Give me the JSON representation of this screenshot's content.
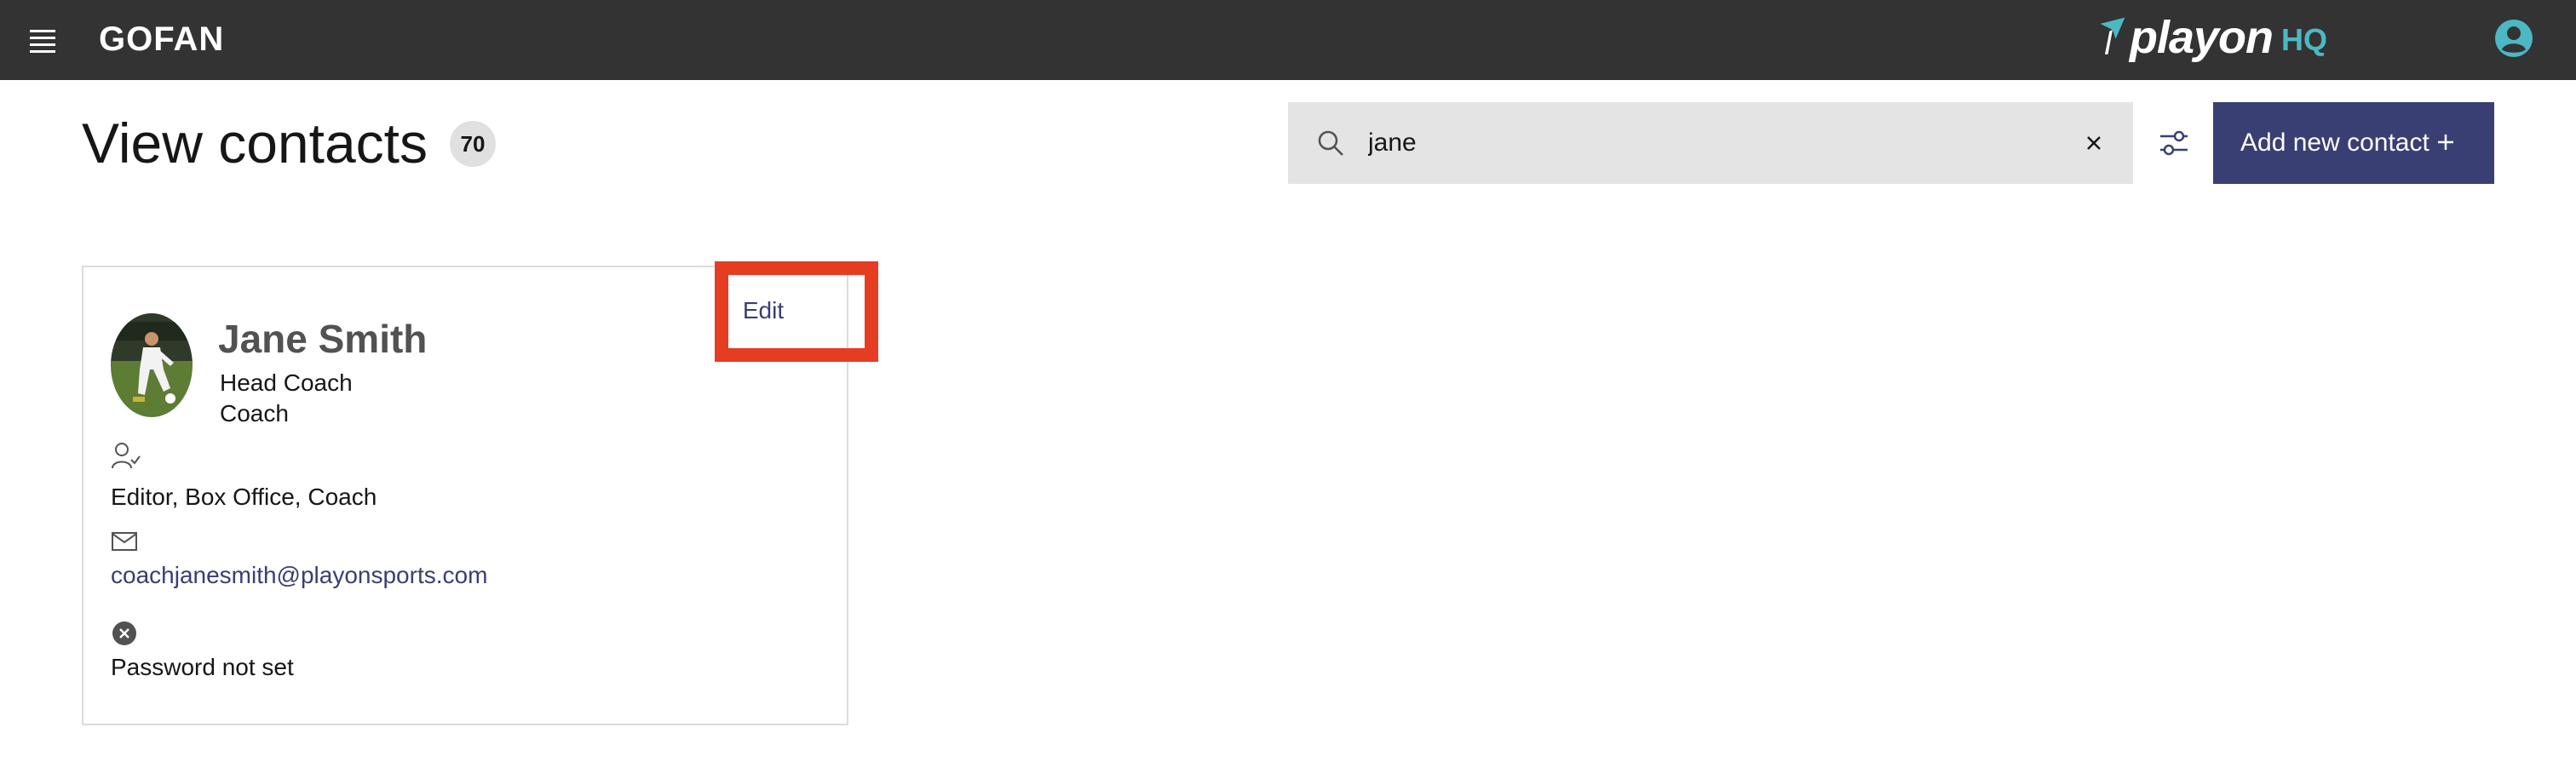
{
  "header": {
    "brand": "GOFAN",
    "partner_logo_word": "playon",
    "partner_logo_suffix": "HQ",
    "menu_icon": "hamburger-menu-icon",
    "account_icon": "user-account-icon"
  },
  "page": {
    "title": "View contacts",
    "count": "70"
  },
  "search": {
    "value": "jane",
    "placeholder": "",
    "icon": "search-icon",
    "clear_icon": "close-icon",
    "filter_icon": "sliders-filter-icon"
  },
  "actions": {
    "add_contact_label": "Add new contact",
    "add_icon": "plus-icon"
  },
  "contacts": [
    {
      "name": "Jane Smith",
      "title": "Head Coach",
      "role": "Coach",
      "permissions": "Editor, Box Office, Coach",
      "email": "coachjanesmith@playonsports.com",
      "password_status": "Password not set",
      "edit_label": "Edit"
    }
  ],
  "colors": {
    "topbar": "#333333",
    "primary": "#393f73",
    "logo_accent": "#4cb8c4",
    "highlight": "#e53d22",
    "search_bg": "#e4e4e4"
  }
}
